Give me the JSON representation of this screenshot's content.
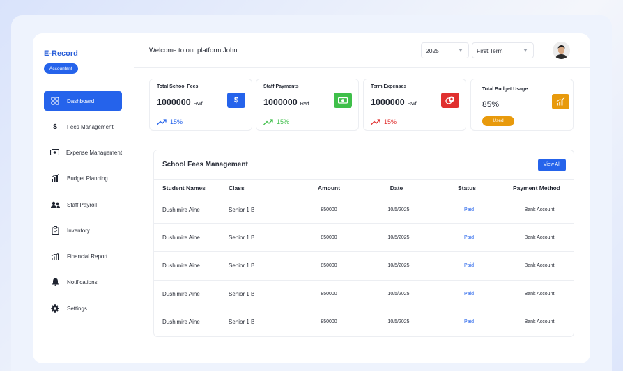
{
  "brand": {
    "name": "E-Record",
    "role": "Accountant"
  },
  "sidebar": {
    "items": [
      {
        "label": "Dashboard",
        "icon": "grid-icon",
        "active": true
      },
      {
        "label": "Fees Management",
        "icon": "dollar-icon"
      },
      {
        "label": "Expense Management",
        "icon": "cash-icon"
      },
      {
        "label": "Budget Planning",
        "icon": "bar-chart-icon"
      },
      {
        "label": "Staff Payroll",
        "icon": "users-icon"
      },
      {
        "label": "Inventory",
        "icon": "clipboard-icon"
      },
      {
        "label": "Financial Report",
        "icon": "growth-chart-icon"
      },
      {
        "label": "Notifications",
        "icon": "bell-icon"
      },
      {
        "label": "Settings",
        "icon": "gear-icon"
      }
    ]
  },
  "header": {
    "welcome": "Welcome to our platform John",
    "year": "2025",
    "term": "First Term",
    "avatar": "user-avatar"
  },
  "stats": [
    {
      "title": "Total School Fees",
      "value": "1000000",
      "unit": "Rwf",
      "trend": "15%",
      "trend_dir": "up",
      "color": "#2563eb",
      "icon": "dollar-icon"
    },
    {
      "title": "Staff Payments",
      "value": "1000000",
      "unit": "Rwf",
      "trend": "15%",
      "trend_dir": "up",
      "color": "#3fbf4a",
      "icon": "cash-icon"
    },
    {
      "title": "Term Expenses",
      "value": "1000000",
      "unit": "Rwf",
      "trend": "15%",
      "trend_dir": "up",
      "color": "#e0302f",
      "icon": "coins-icon"
    },
    {
      "title": "Total Budget Usage",
      "value": "85%",
      "badge": "Used",
      "color": "#e89a0c",
      "icon": "bar-chart-icon"
    }
  ],
  "table": {
    "title": "School Fees Management",
    "view_all": "View All",
    "columns": [
      "Student Names",
      "Class",
      "Amount",
      "Date",
      "Status",
      "Payment Method"
    ],
    "rows": [
      [
        "Dushimire Aine",
        "Senior 1 B",
        "850000",
        "10/5/2025",
        "Paid",
        "Bank Account"
      ],
      [
        "Dushimire Aine",
        "Senior 1 B",
        "850000",
        "10/5/2025",
        "Paid",
        "Bank Account"
      ],
      [
        "Dushimire Aine",
        "Senior 1 B",
        "850000",
        "10/5/2025",
        "Paid",
        "Bank Account"
      ],
      [
        "Dushimire Aine",
        "Senior 1 B",
        "850000",
        "10/5/2025",
        "Paid",
        "Bank Account"
      ],
      [
        "Dushimire Aine",
        "Senior 1 B",
        "850000",
        "10/5/2025",
        "Paid",
        "Bank Account"
      ]
    ]
  }
}
